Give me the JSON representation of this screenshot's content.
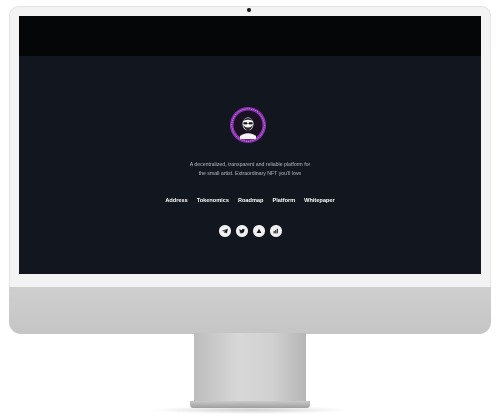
{
  "hero": {
    "tagline_line1": "A decentralized, transparent and reliable platform for",
    "tagline_line2": "the small artist. Extraordinary NFT you'll love"
  },
  "nav": {
    "items": [
      "Address",
      "Tokenomics",
      "Roadmap",
      "Platform",
      "Whitepaper"
    ]
  },
  "social": {
    "icons": [
      "telegram-icon",
      "twitter-icon",
      "dappradar-icon",
      "chart-icon"
    ]
  },
  "colors": {
    "screen_bg": "#12171f",
    "topbar_bg": "#050608",
    "logo_accent": "#8a2fb0",
    "nav_text": "#ffffff",
    "tagline_text": "#b8bcc3"
  }
}
